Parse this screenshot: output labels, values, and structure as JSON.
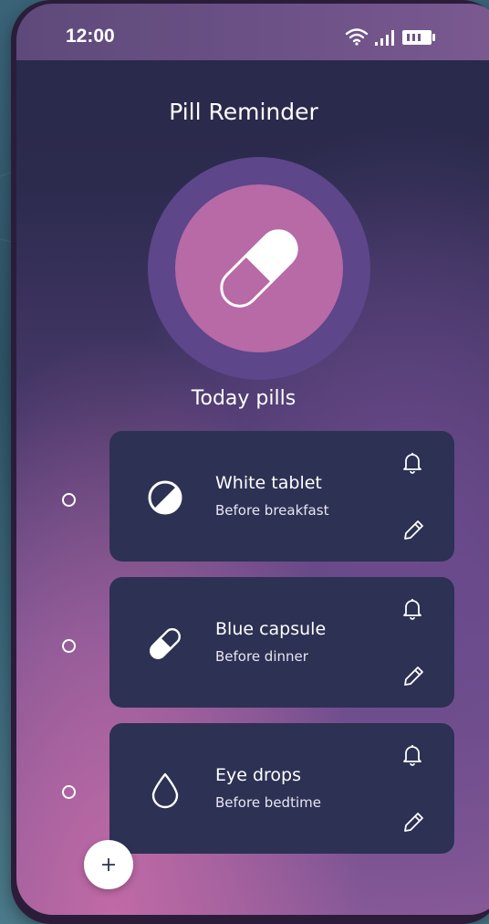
{
  "status_bar": {
    "time": "12:00",
    "wifi_icon": "wifi-icon",
    "signal_icon": "signal-icon",
    "battery_icon": "battery-icon"
  },
  "app": {
    "title": "Pill Reminder",
    "hero_icon": "capsule-icon",
    "subtitle": "Today pills"
  },
  "medications": [
    {
      "name": "White tablet",
      "when": "Before breakfast",
      "icon": "tablet-icon",
      "taken": false
    },
    {
      "name": "Blue capsule",
      "when": "Before dinner",
      "icon": "capsule-icon",
      "taken": false
    },
    {
      "name": "Eye drops",
      "when": "Before bedtime",
      "icon": "drop-icon",
      "taken": false
    }
  ],
  "actions": {
    "add_icon": "plus-icon",
    "reminder_icon": "bell-icon",
    "edit_icon": "pencil-icon"
  },
  "colors": {
    "card": "#2d3154",
    "pill_ring": "#5d4689",
    "pill_fill": "#b76aa6",
    "status_bar": "#6e5288"
  }
}
